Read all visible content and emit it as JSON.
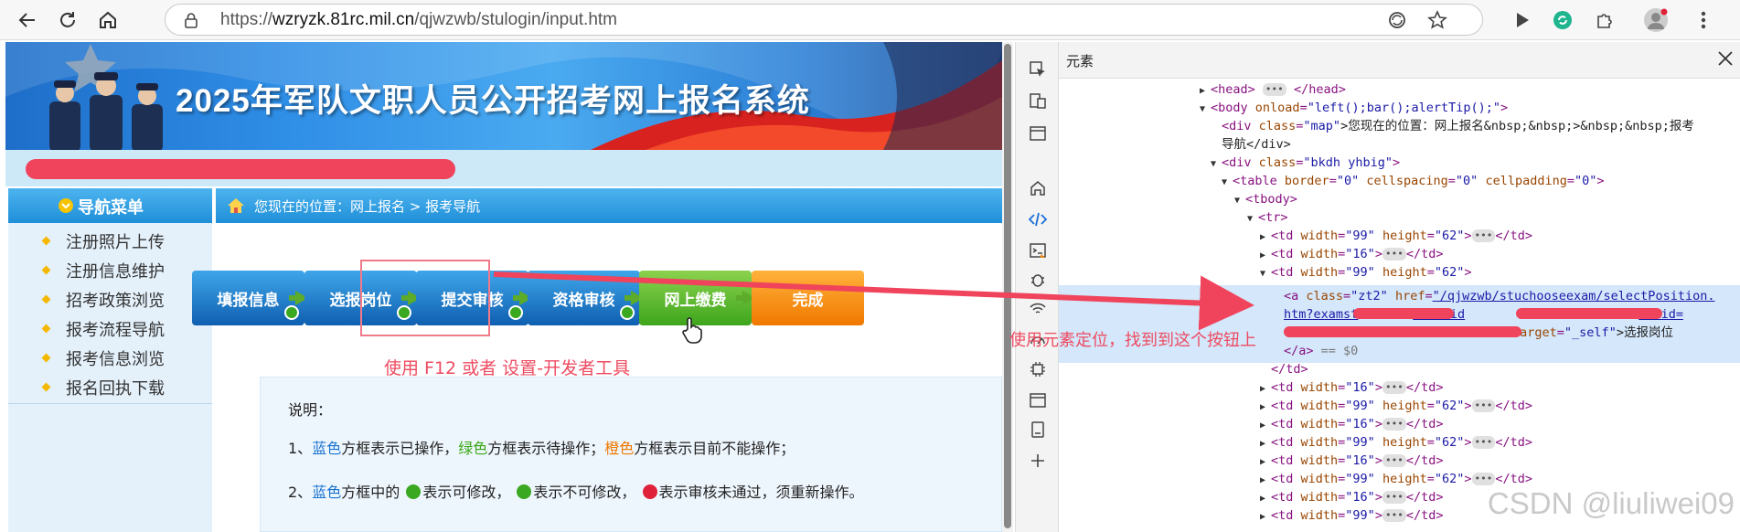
{
  "browser": {
    "url_prefix": "https://",
    "url_host": "wzryzk.81rc.mil.cn",
    "url_path": "/qjwzwb/stulogin/input.htm"
  },
  "page": {
    "banner_title": "2025年军队文职人员公开招考网上报名系统",
    "sidebar": {
      "header": "导航菜单",
      "items": [
        {
          "label": "注册照片上传"
        },
        {
          "label": "注册信息维护"
        },
        {
          "label": "招考政策浏览"
        },
        {
          "label": "报考流程导航"
        },
        {
          "label": "报考信息浏览"
        },
        {
          "label": "报名回执下载"
        }
      ]
    },
    "breadcrumb": "您现在的位置：网上报名  >  报考导航",
    "steps": [
      {
        "label": "填报信息",
        "color": "blue"
      },
      {
        "label": "选报岗位",
        "color": "blue"
      },
      {
        "label": "提交审核",
        "color": "blue"
      },
      {
        "label": "资格审核",
        "color": "blue"
      },
      {
        "label": "网上缴费",
        "color": "green"
      },
      {
        "label": "完成",
        "color": "orange"
      }
    ],
    "hint_f12": "使用 F12 或者 设置-开发者工具",
    "notes": {
      "title": "说明：",
      "line1": {
        "p1": "1、",
        "blue": "蓝色",
        "p2": "方框表示已操作，",
        "green": "绿色",
        "p3": "方框表示待操作；",
        "orange": "橙色",
        "p4": "方框表示目前不能操作；"
      },
      "line2": {
        "p1": "2、",
        "blue": "蓝色",
        "p2": "方框中的",
        "t1": "表示可修改，",
        "t2": "表示不可修改，",
        "t3": "表示审核未通过，须重新操作。"
      }
    }
  },
  "devtools": {
    "tab_label": "元素",
    "dom": {
      "l1_tag": "<head>",
      "l1_end": "</head>",
      "l2_open": "<body ",
      "l2_attr": "onload",
      "l2_val": "\"left();bar();alertTip();\"",
      "l2_close": ">",
      "l3_open": "<div ",
      "l3_attr": "class",
      "l3_val": "\"map\"",
      "l3_text": ">您现在的位置：网上报名&nbsp;&nbsp;>&nbsp;&nbsp;报考",
      "l4_text": "导航</div>",
      "l5_open": "<div ",
      "l5_attr": "class",
      "l5_val": "\"bkdh yhbig\"",
      "l5_close": ">",
      "l6_open": "<table ",
      "l6_a1": "border",
      "l6_v1": "\"0\"",
      "l6_a2": "cellspacing",
      "l6_v2": "\"0\"",
      "l6_a3": "cellpadding",
      "l6_v3": "\"0\"",
      "l6_close": ">",
      "l7": "<tbody>",
      "l8": "<tr>",
      "td_open": "<td ",
      "td_w": "width",
      "v99": "\"99\"",
      "td_h": "height",
      "v62": "\"62\"",
      "v16": "\"16\"",
      "td_end": "</td>",
      "ellipsis": "•••",
      "a_open": "<a ",
      "a_class": "class",
      "a_class_v": "\"zt2\"",
      "a_href": "href",
      "a_href_v": "\"/qjwzwb/stuchooseexam/selectPosition.",
      "a_line2": "htm?examst",
      "a_line2b": "&userid",
      "a_line2c": "&bmid=",
      "a_target": "target",
      "a_target_v": "\"_self\"",
      "a_text": ">选报岗位",
      "a_close": "</a>",
      "eq0": "== $0",
      "td_close": "</td>"
    },
    "hint": "使用元素定位，找到到这个按钮上",
    "watermark": "CSDN @liuliwei09"
  }
}
